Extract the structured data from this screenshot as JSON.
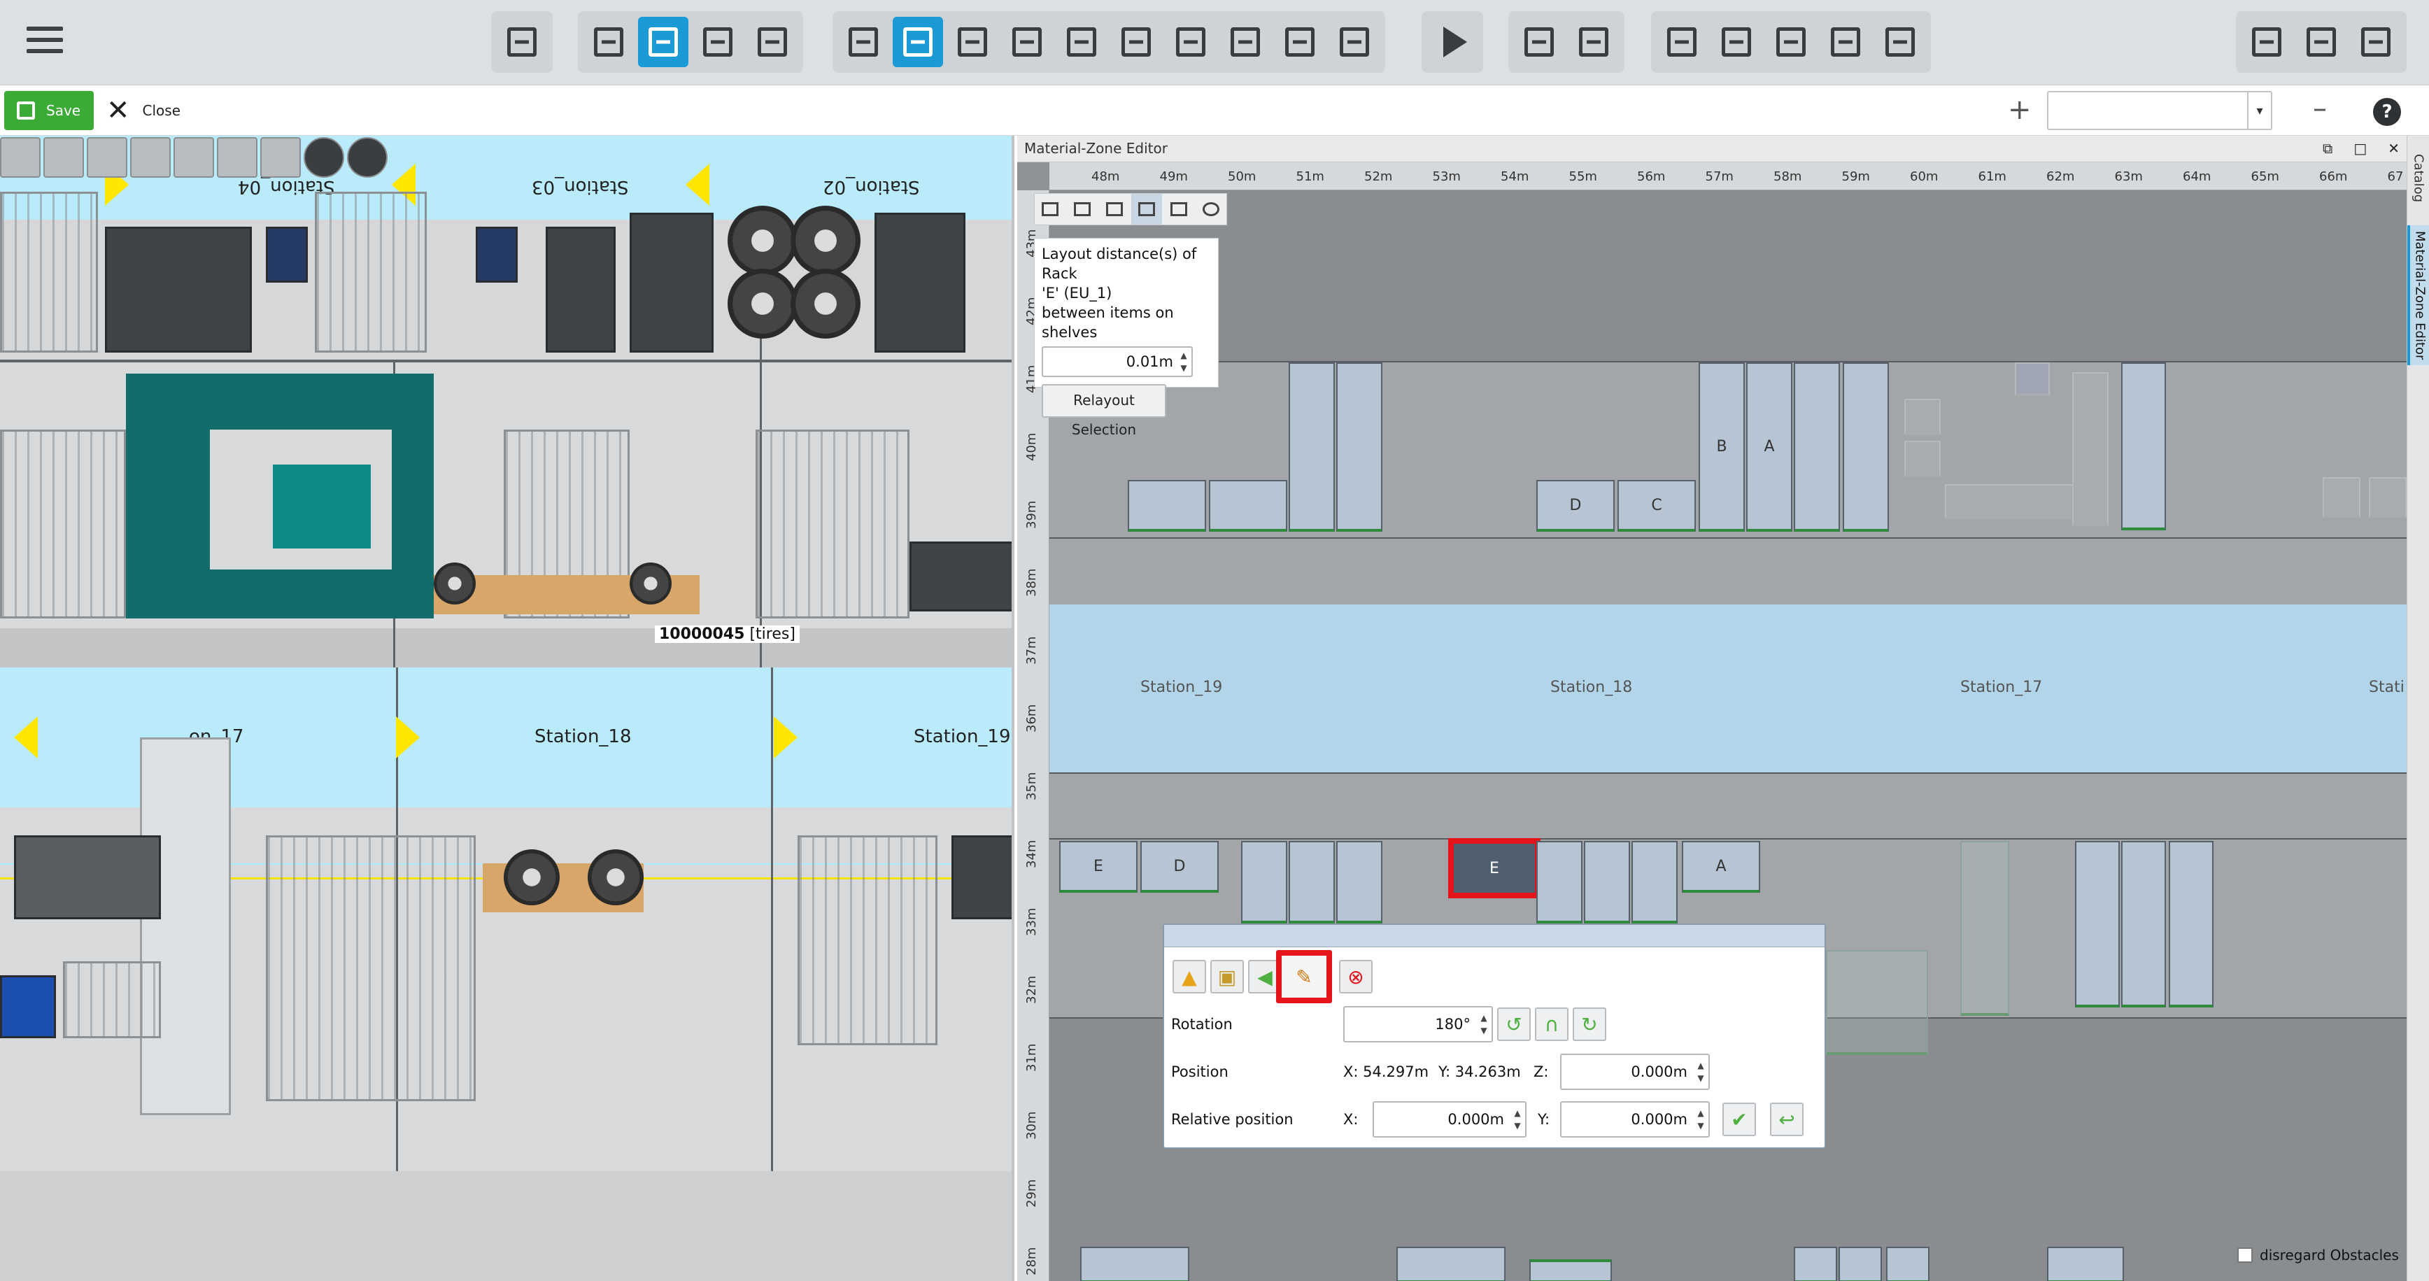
{
  "toolbar": {
    "menu_icon": "hamburger-icon",
    "groups": [
      {
        "icons": [
          "sidebar-toggle-icon"
        ]
      },
      {
        "icons": [
          "folder-open-icon",
          "layout-icon",
          "station-icon",
          "document-warning-icon"
        ],
        "active": "layout-icon"
      },
      {
        "icons": [
          "frame-icon",
          "rack-view-icon",
          "warehouse-icon",
          "vehicle-icon",
          "shelf-icon",
          "grid-shelf-icon",
          "table-icon",
          "edit-table-icon",
          "align-icon",
          "bookmark-icon"
        ],
        "active": "rack-view-icon"
      },
      {
        "icons": [
          "play-icon"
        ]
      },
      {
        "icons": [
          "cursor-select-icon",
          "filter-icon"
        ]
      },
      {
        "icons": [
          "network-icon",
          "clipboard-icon",
          "chart-icon",
          "screenshot-icon",
          "person-info-icon"
        ]
      },
      {
        "icons": [
          "plugin-icon",
          "sliders-icon",
          "hierarchy-icon"
        ]
      }
    ]
  },
  "secbar": {
    "save_label": "Save",
    "close_label": "Close",
    "combo_value": ""
  },
  "view3d": {
    "top_stations": [
      "Station_04",
      "Station_03",
      "Station_02"
    ],
    "mid_stations": [
      "on_17",
      "Station_18",
      "Station_19"
    ],
    "material_id": "10000045",
    "material_tag": "[tires]"
  },
  "editor": {
    "title": "Material-Zone Editor",
    "ruler_x": [
      "48m",
      "49m",
      "50m",
      "51m",
      "52m",
      "53m",
      "54m",
      "55m",
      "56m",
      "57m",
      "58m",
      "59m",
      "60m",
      "61m",
      "62m",
      "63m",
      "64m",
      "65m",
      "66m",
      "67"
    ],
    "ruler_y": [
      "43m",
      "42m",
      "41m",
      "40m",
      "39m",
      "38m",
      "37m",
      "36m",
      "35m",
      "34m",
      "33m",
      "32m",
      "31m",
      "30m",
      "29m",
      "28m"
    ],
    "dist_panel": {
      "line1": "Layout distance(s) of Rack",
      "line2": "'E' (EU_1)",
      "line3": "between items on shelves",
      "value": "0.01m",
      "button": "Relayout Selection"
    },
    "stations": [
      "Station_19",
      "Station_18",
      "Station_17",
      "Stati"
    ],
    "upper_racks": {
      "labels": [
        "D",
        "C",
        "B",
        "A"
      ]
    },
    "lower_racks": {
      "labels": [
        "E",
        "D",
        "E",
        "A"
      ]
    },
    "popup": {
      "rotation_label": "Rotation",
      "rotation_value": "180°",
      "position_label": "Position",
      "position_x": "X: 54.297m",
      "position_y": "Y: 34.263m",
      "z_label": "Z:",
      "z_value": "0.000m",
      "relpos_label": "Relative position",
      "rel_x_label": "X:",
      "rel_x_value": "0.000m",
      "rel_y_label": "Y:",
      "rel_y_value": "0.000m"
    },
    "disregard_label": "disregard Obstacles"
  },
  "side_tabs": {
    "catalog": "Catalog",
    "mz_editor": "Material-Zone Editor"
  }
}
